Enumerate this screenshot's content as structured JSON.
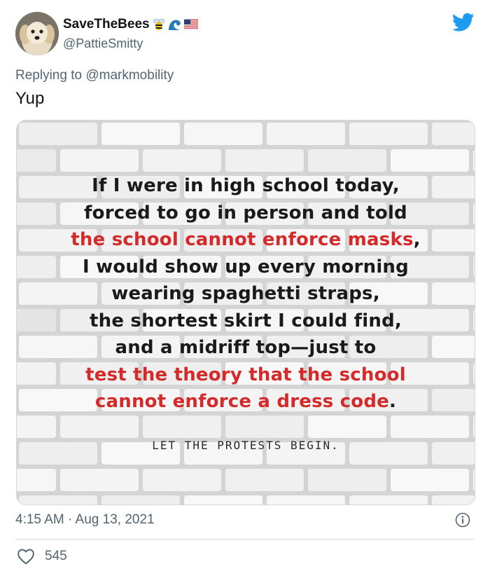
{
  "tweet": {
    "display_name": "SaveTheBees",
    "handle": "@PattieSmitty",
    "reply_prefix": "Replying to ",
    "reply_mention": "@markmobility",
    "text": "Yup",
    "timestamp": "4:15 AM · Aug 13, 2021",
    "like_count": "545",
    "icons": [
      "bee-emoji",
      "wave-emoji",
      "us-flag-emoji",
      "twitter-logo-icon",
      "info-icon",
      "heart-icon"
    ],
    "accent_color": "#1d9bf0"
  },
  "image": {
    "lines": [
      {
        "parts": [
          {
            "text": "If I were in high school today,",
            "red": false
          }
        ]
      },
      {
        "parts": [
          {
            "text": "forced to go in person and told",
            "red": false
          }
        ]
      },
      {
        "parts": [
          {
            "text": "the school cannot enforce masks",
            "red": true
          },
          {
            "text": ",",
            "red": false
          }
        ]
      },
      {
        "parts": [
          {
            "text": "I would show up every morning",
            "red": false
          }
        ]
      },
      {
        "parts": [
          {
            "text": "wearing spaghetti straps,",
            "red": false
          }
        ]
      },
      {
        "parts": [
          {
            "text": "the shortest skirt I could find,",
            "red": false
          }
        ]
      },
      {
        "parts": [
          {
            "text": "and a midriff top—just to",
            "red": false
          }
        ]
      },
      {
        "parts": [
          {
            "text": "test the theory that the school",
            "red": true
          }
        ]
      },
      {
        "parts": [
          {
            "text": "cannot enforce a dress code",
            "red": true
          },
          {
            "text": ".",
            "red": false
          }
        ]
      }
    ],
    "footer": "LET THE PROTESTS BEGIN.",
    "text_color": "#1a1a1a",
    "highlight_color": "#d42a2a"
  }
}
